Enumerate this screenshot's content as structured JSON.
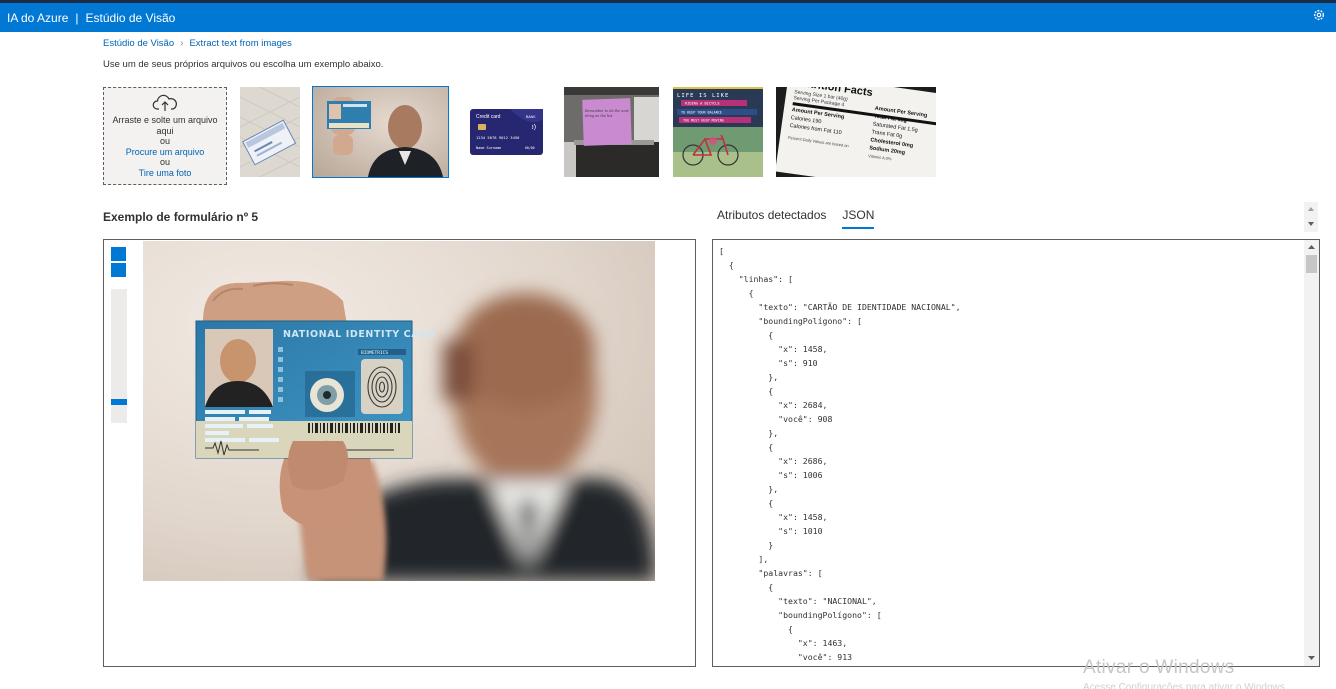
{
  "header": {
    "brand": "IA do Azure",
    "separator": "|",
    "product": "Estúdio de Visão",
    "settings_icon": "gear-icon"
  },
  "breadcrumb": {
    "root": "Estúdio de Visão",
    "current": "Extract text from images"
  },
  "subtitle": "Use um de seus próprios arquivos ou escolha um exemplo abaixo.",
  "upload": {
    "icon": "cloud-upload-icon",
    "drag_text": "Arraste e solte um arquivo aqui",
    "or_1": "ou",
    "browse_link": "Procure um arquivo",
    "or_2": "ou",
    "photo_link": "Tire uma foto"
  },
  "samples": {
    "credit_card": {
      "brand": "Credit card",
      "bank": "BANK",
      "number": "1234 5678 9012 3456",
      "name": "Name Surname",
      "expiry": "00/00"
    },
    "sticky_note": {
      "text": "Remember to do the next thing on the list"
    },
    "bicycle_poster": {
      "line1": "LIFE IS LIKE",
      "line2": "RIDING A BICYCLE",
      "line3": "TO KEEP YOUR BALANCE",
      "line4": "YOU MUST KEEP MOVING"
    },
    "nutrition": {
      "title": "Nutrition Facts",
      "serving_size": "Serving Size 1 bar (40g)",
      "servings": "Serving Per Package 4",
      "amount": "Amount Per Serving",
      "calories": "Calories 190",
      "fat_calories": "Calories from Fat 110",
      "total_fat": "Total Fat 13g",
      "sat_fat": "Saturated Fat 1.5g",
      "trans_fat": "Trans Fat 0g",
      "cholesterol": "Cholesterol 0mg",
      "sodium": "Sodium 20mg",
      "daily_values": "Percent Daily Values are based on",
      "vitamin": "Vitamin A 0%"
    }
  },
  "section_title": "Exemplo de formulário nº 5",
  "tabs": [
    {
      "label": "Atributos detectados",
      "active": false
    },
    {
      "label": "JSON",
      "active": true
    }
  ],
  "id_card": {
    "title": "NATIONAL IDENTITY CARD",
    "biometrics": "BIOMETRICS"
  },
  "json_lines": [
    "[",
    "  {",
    "    \"linhas\": [",
    "      {",
    "        \"texto\": \"CARTÃO DE IDENTIDADE NACIONAL\",",
    "        \"boundingPolígono\": [",
    "          {",
    "            \"x\": 1458,",
    "            \"s\": 910",
    "          },",
    "          {",
    "            \"x\": 2684,",
    "            \"você\": 908",
    "          },",
    "          {",
    "            \"x\": 2686,",
    "            \"s\": 1006",
    "          },",
    "          {",
    "            \"x\": 1458,",
    "            \"s\": 1010",
    "          }",
    "        ],",
    "        \"palavras\": [",
    "          {",
    "            \"texto\": \"NACIONAL\",",
    "            \"boundingPolígono\": [",
    "              {",
    "                \"x\": 1463,",
    "                \"você\": 913"
  ],
  "zoom": {
    "level": 0.86
  },
  "watermark": {
    "title": "Ativar o Windows",
    "subtitle": "Acesse Configurações para ativar o Windows."
  },
  "colors": {
    "accent": "#0078d4",
    "topbar": "#0078d4",
    "link": "#0063b1"
  }
}
